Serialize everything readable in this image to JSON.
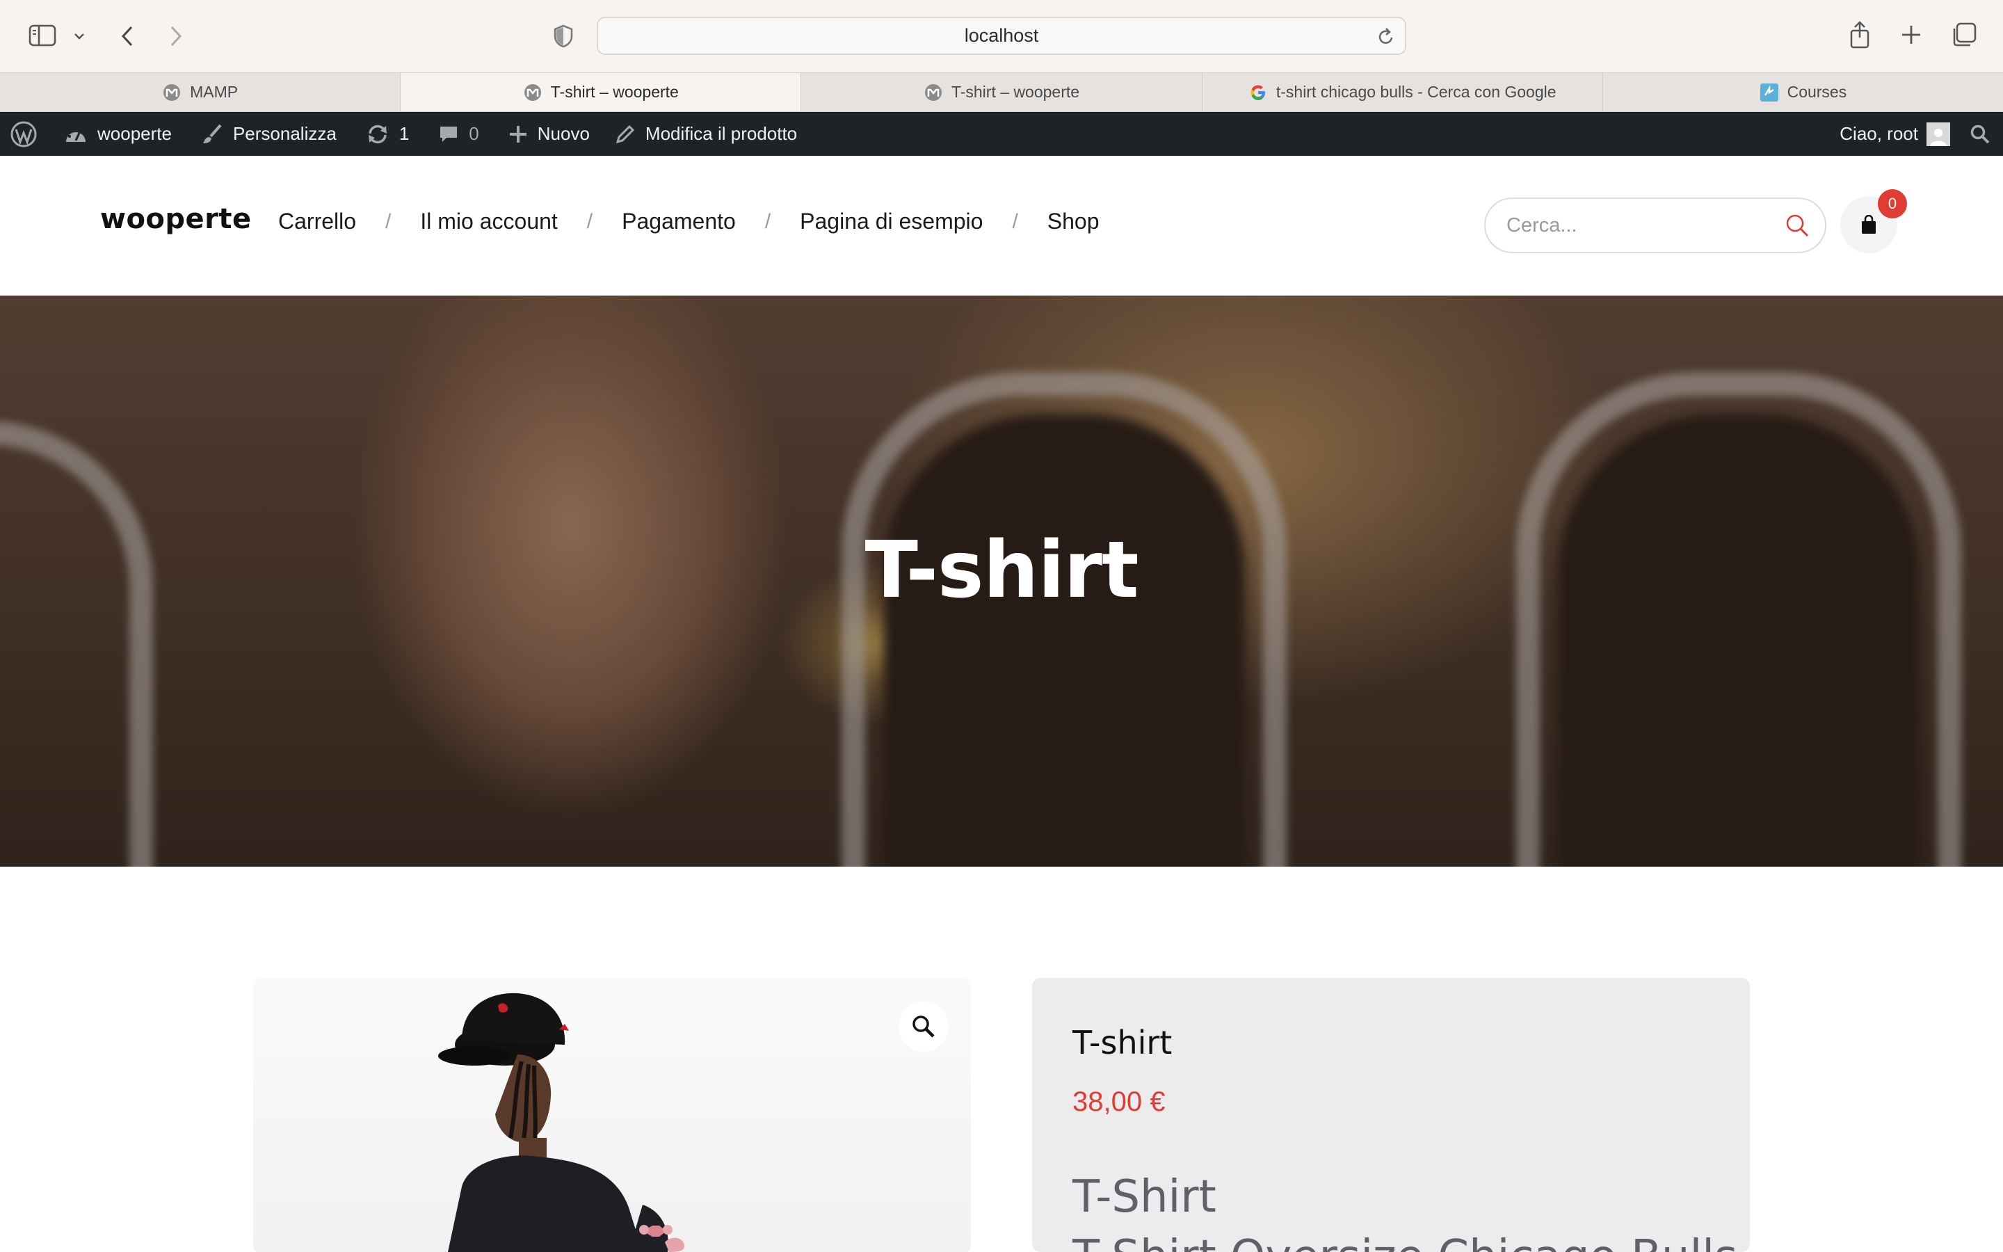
{
  "browser": {
    "url": "localhost",
    "tabs": [
      {
        "label": "MAMP",
        "icon": "mamp-favicon",
        "active": false
      },
      {
        "label": "T-shirt – wooperte",
        "icon": "mamp-favicon",
        "active": true
      },
      {
        "label": "T-shirt – wooperte",
        "icon": "mamp-favicon",
        "active": false
      },
      {
        "label": "t-shirt chicago bulls - Cerca con Google",
        "icon": "google-favicon",
        "active": false
      },
      {
        "label": "Courses",
        "icon": "courses-favicon",
        "active": false
      }
    ]
  },
  "adminbar": {
    "site_name": "wooperte",
    "customize": "Personalizza",
    "updates_count": "1",
    "comments_count": "0",
    "new_label": "Nuovo",
    "edit_label": "Modifica il prodotto",
    "greeting": "Ciao, root"
  },
  "header": {
    "logo": "wooperte",
    "nav": [
      "Carrello",
      "Il mio account",
      "Pagamento",
      "Pagina di esempio",
      "Shop"
    ],
    "nav_separator": "/",
    "search_placeholder": "Cerca...",
    "cart_count": "0"
  },
  "hero": {
    "title": "T-shirt"
  },
  "product": {
    "title": "T-shirt",
    "price": "38,00 €",
    "subtitle": "T-Shirt",
    "subtitle_line2": "T-Shirt Oversize Chicago Bulls NBA"
  },
  "colors": {
    "accent": "#e03c31",
    "adminbar_bg": "#1d2327",
    "summary_bg": "#ececee"
  }
}
